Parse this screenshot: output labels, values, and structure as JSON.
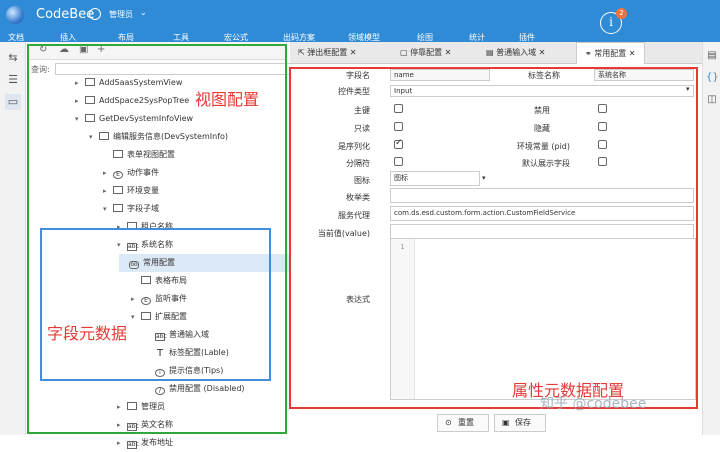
{
  "app": {
    "name": "CodeBee",
    "user": "管理员",
    "notifications": "2"
  },
  "menu": [
    "文档",
    "插入",
    "布局",
    "工具",
    "宏公式",
    "出码方案",
    "领域模型",
    "绘图",
    "统计",
    "插件"
  ],
  "tree": {
    "search_label": "查询:",
    "rows": [
      {
        "label": "AddSaasSystemView",
        "level": 0
      },
      {
        "label": "AddSpace2SysPopTree",
        "level": 0
      },
      {
        "label": "GetDevSystemInfoView",
        "level": 0
      },
      {
        "label": "编辑服务信息(DevSystemInfo)",
        "level": 1
      },
      {
        "label": "表单视图配置",
        "level": 2
      },
      {
        "label": "动作事件",
        "level": 2
      },
      {
        "label": "环境变量",
        "level": 2
      },
      {
        "label": "字段子域",
        "level": 2
      },
      {
        "label": "租户名称",
        "level": 3
      },
      {
        "label": "系统名称",
        "level": 3
      },
      {
        "label": "常用配置",
        "level": 4
      },
      {
        "label": "表格布局",
        "level": 4
      },
      {
        "label": "监听事件",
        "level": 4
      },
      {
        "label": "扩展配置",
        "level": 4
      },
      {
        "label": "普通输入域",
        "level": 4
      },
      {
        "label": "标签配置(Lable)",
        "level": 4
      },
      {
        "label": "提示信息(Tips)",
        "level": 4
      },
      {
        "label": "禁用配置 (Disabled)",
        "level": 4
      },
      {
        "label": "管理员",
        "level": 3
      },
      {
        "label": "英文名称",
        "level": 3
      },
      {
        "label": "发布地址",
        "level": 3
      }
    ]
  },
  "annotations": {
    "view": "视图配置",
    "field": "字段元数据",
    "attr": "属性元数据配置"
  },
  "tabs": [
    "弹出框配置",
    "停靠配置",
    "普通输入域",
    "常用配置"
  ],
  "form": {
    "field_name_label": "字段名",
    "field_name_value": "name",
    "tag_name_label": "标签名称",
    "tag_name_value": "系统名称",
    "control_type_label": "控件类型",
    "control_type_value": "Input",
    "primary_label": "主键",
    "disabled_label": "禁用",
    "readonly_label": "只读",
    "hidden_label": "隐藏",
    "serialize_label": "是序列化",
    "env_label": "环境常量 (pid)",
    "separator_label": "分隔符",
    "default_show_label": "默认展示字段",
    "icon_label": "图标",
    "icon_value": "图标",
    "enum_label": "枚举类",
    "service_label": "服务代理",
    "service_value": "com.ds.esd.custom.form.action.CustomFieldService",
    "current_label": "当前值(value)",
    "expr_label": "表达式",
    "line_no": "1"
  },
  "buttons": {
    "reset": "重置",
    "save": "保存"
  },
  "watermark": "知乎 @codebee",
  "colors": {
    "topbar": "#2f8bd6",
    "green": "#2fa83a",
    "blue": "#3f8fdc",
    "red": "#e53935"
  }
}
